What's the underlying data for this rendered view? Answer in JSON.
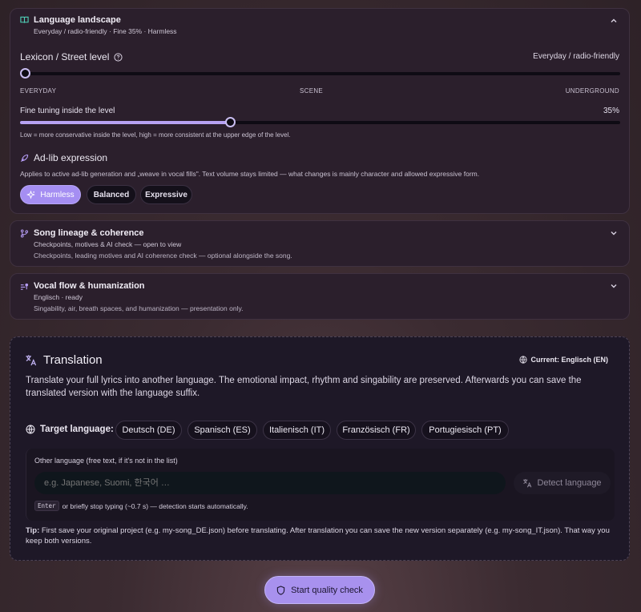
{
  "landscape": {
    "title": "Language landscape",
    "summary": "Everyday / radio-friendly · Fine 35% · Harmless",
    "lexicon_label": "Lexicon / Street level",
    "lexicon_value": "Everyday / radio-friendly",
    "scale_labels": [
      "EVERYDAY",
      "SCENE",
      "UNDERGROUND"
    ],
    "lexicon_level": 0,
    "fine_label": "Fine tuning inside the level",
    "fine_value": "35%",
    "fine_level": 0.35,
    "fine_hint": "Low = more conservative inside the level, high = more consistent at the upper edge of the level.",
    "adlib_title": "Ad-lib expression",
    "adlib_desc": "Applies to active ad-lib generation and „weave in vocal fills\". Text volume stays limited — what changes is mainly character and allowed expressive form.",
    "adlib_options": [
      "Harmless",
      "Balanced",
      "Expressive"
    ],
    "adlib_selected": "Harmless"
  },
  "lineage": {
    "title": "Song lineage & coherence",
    "status": "Checkpoints, motives & AI check — open to view",
    "desc": "Checkpoints, leading motives and AI coherence check — optional alongside the song."
  },
  "vocal": {
    "title": "Vocal flow & humanization",
    "status": "Englisch · ready",
    "desc": "Singability, air, breath spaces, and humanization — presentation only."
  },
  "translation": {
    "title": "Translation",
    "current": "Current: Englisch (EN)",
    "desc": "Translate your full lyrics into another language. The emotional impact, rhythm and singability are preserved. Afterwards you can save the translated version with the language suffix.",
    "target_label": "Target language:",
    "languages": [
      "Deutsch (DE)",
      "Spanisch (ES)",
      "Italienisch (IT)",
      "Französisch (FR)",
      "Portugiesisch (PT)"
    ],
    "other_label": "Other language (free text, if it's not in the list)",
    "other_placeholder": "e.g. Japanese, Suomi, 한국어 …",
    "detect_label": "Detect language",
    "enter_key": "Enter",
    "enter_hint": "or briefly stop typing (~0.7 s) — detection starts automatically.",
    "tip_label": "Tip:",
    "tip_text": "First save your original project (e.g. my-song_DE.json) before translating. After translation you can save the new version separately (e.g. my-song_IT.json). That way you keep both versions."
  },
  "actions": {
    "start_label": "Start quality check"
  },
  "colors": {
    "accent": "#a58ef2",
    "panel": "#2b1f2c",
    "teal_icon": "#4fd1b8"
  }
}
